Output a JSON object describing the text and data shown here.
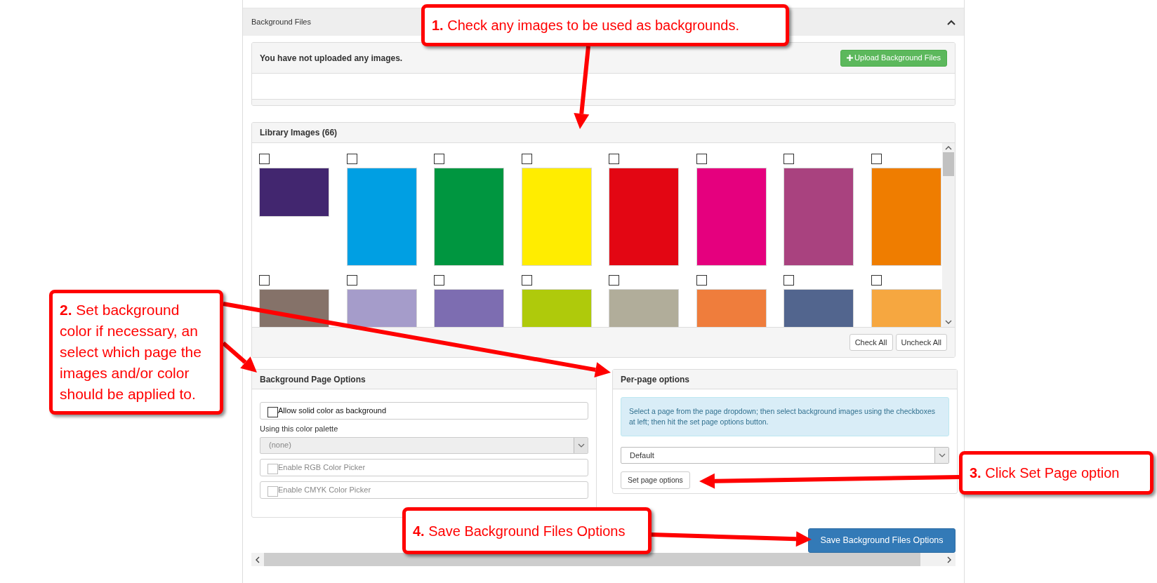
{
  "section": {
    "title": "Background Files",
    "expanded": true
  },
  "uploads": {
    "message": "You have not uploaded any images.",
    "upload_button": "Upload Background Files"
  },
  "library": {
    "title": "Library Images (66)",
    "images": [
      {
        "color": "#42266f",
        "checked": false,
        "kind": "wide"
      },
      {
        "color": "#009fe3",
        "checked": false,
        "kind": "tall"
      },
      {
        "color": "#009640",
        "checked": false,
        "kind": "tall"
      },
      {
        "color": "#ffed00",
        "checked": false,
        "kind": "tall"
      },
      {
        "color": "#e30613",
        "checked": false,
        "kind": "tall"
      },
      {
        "color": "#e5007e",
        "checked": false,
        "kind": "tall"
      },
      {
        "color": "#a9427f",
        "checked": false,
        "kind": "tall"
      },
      {
        "color": "#ef7d00",
        "checked": false,
        "kind": "tall"
      },
      {
        "color": "#857269",
        "checked": false,
        "kind": "tall"
      },
      {
        "color": "#a59cca",
        "checked": false,
        "kind": "tall"
      },
      {
        "color": "#7d6db1",
        "checked": false,
        "kind": "tall"
      },
      {
        "color": "#afca0b",
        "checked": false,
        "kind": "tall"
      },
      {
        "color": "#b1ad9a",
        "checked": false,
        "kind": "tall"
      },
      {
        "color": "#ef7d3c",
        "checked": false,
        "kind": "tall"
      },
      {
        "color": "#52658e",
        "checked": false,
        "kind": "tall"
      },
      {
        "color": "#f6a740",
        "checked": false,
        "kind": "tall"
      }
    ],
    "buttons": [
      "Check All",
      "Uncheck All"
    ]
  },
  "page_options": {
    "title": "Background Page Options",
    "solid_color": {
      "label": "Allow solid color as background",
      "checked": false,
      "disabled": false
    },
    "palette_label": "Using this color palette",
    "palette_select": {
      "value": "(none)",
      "disabled": true
    },
    "pickers": [
      {
        "label": "Enable RGB Color Picker",
        "checked": false,
        "disabled": true
      },
      {
        "label": "Enable CMYK Color Picker",
        "checked": false,
        "disabled": true
      }
    ]
  },
  "per_page": {
    "title": "Per-page options",
    "info": "Select a page from the page dropdown; then select background images using the checkboxes at left; then hit the set page options button.",
    "page_select": "Default",
    "set_button": "Set page options"
  },
  "save_button": "Save Background Files Options",
  "callouts": [
    "**1.** Check any images to be used as backgrounds.",
    "**2.** Set background color if necessary, an select which page the images and/or color should be applied to.",
    "**3.** Click Set Page option",
    "**4.** Save Background Files Options"
  ]
}
